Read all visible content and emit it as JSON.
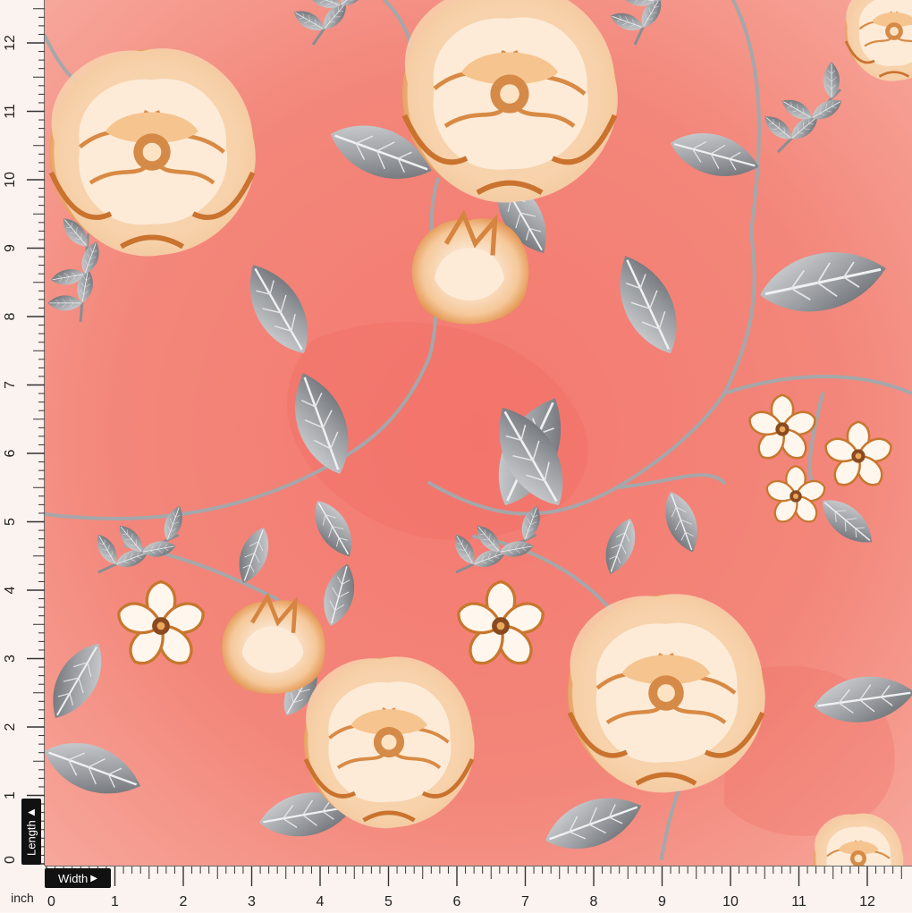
{
  "ruler": {
    "unit": "inch",
    "length_label": "Length",
    "width_label": "Width",
    "arrow_glyph": "▶",
    "vertical_numbers": [
      "0",
      "1",
      "2",
      "3",
      "4",
      "5",
      "6",
      "7",
      "8",
      "9",
      "10",
      "11",
      "12"
    ],
    "horizontal_numbers": [
      "0",
      "1",
      "2",
      "3",
      "4",
      "5",
      "6",
      "7",
      "8",
      "9",
      "10",
      "11",
      "12"
    ]
  },
  "colors": {
    "background": "#f3867a",
    "background_light": "#f7a69a",
    "rose_light": "#fbe9d6",
    "rose_mid": "#f3c493",
    "rose_dark": "#d6823b",
    "leaf_light": "#c9cbce",
    "leaf_dark": "#6b6e73",
    "stem": "#a5a7aa",
    "blossom_white": "#fff7ee",
    "blossom_edge": "#c7772e"
  }
}
